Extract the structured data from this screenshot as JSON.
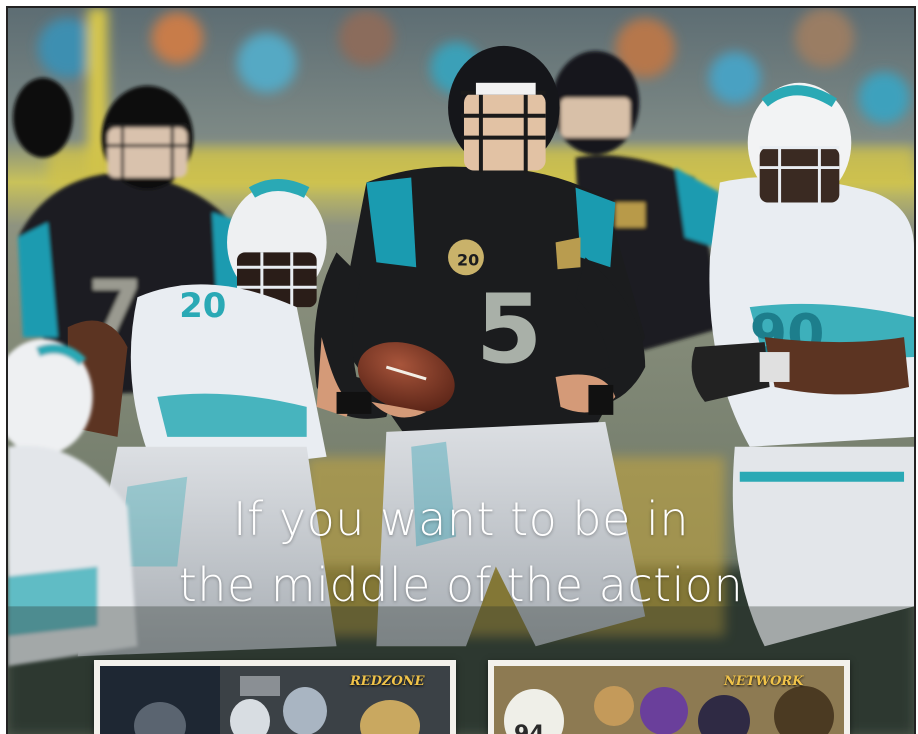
{
  "headline": {
    "line1": "If you want to be in",
    "line2": "the middle of the action"
  },
  "players": {
    "qb_number": "5",
    "left_number": "7",
    "dolphin_number": "20",
    "right_number": "90"
  },
  "patch": "20",
  "thumbnails": {
    "left_label": "REDZONE",
    "right_label": "NETWORK",
    "right_jersey": "94"
  },
  "colors": {
    "jaguars_teal": "#1a9bb0",
    "jaguars_black": "#1b1c1e",
    "dolphins_white": "#e9edf2",
    "dolphins_aqua": "#2aa9b5",
    "field_gold": "#d8b43a"
  }
}
